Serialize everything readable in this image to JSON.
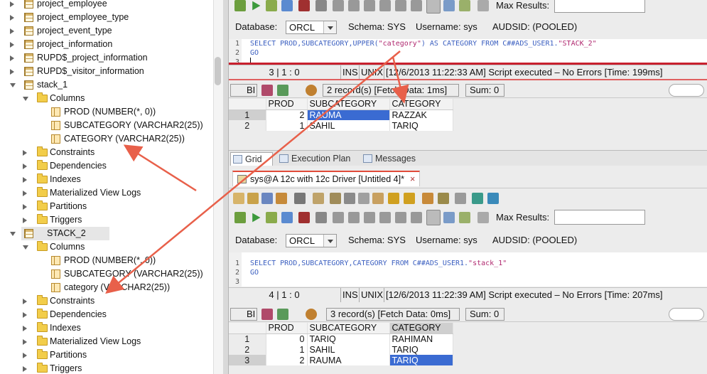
{
  "tree": {
    "items": [
      {
        "label": "project_employee",
        "icon": "table-icon"
      },
      {
        "label": "project_employee_type",
        "icon": "table-icon"
      },
      {
        "label": "project_event_type",
        "icon": "table-icon"
      },
      {
        "label": "project_information",
        "icon": "table-icon"
      },
      {
        "label": "RUPD$_project_information",
        "icon": "table-icon"
      },
      {
        "label": "RUPD$_visitor_information",
        "icon": "table-icon"
      },
      {
        "label": "stack_1",
        "icon": "table-icon"
      },
      {
        "label": "Columns",
        "icon": "folder-icon"
      },
      {
        "label": "PROD (NUMBER(*, 0))",
        "icon": "column-icon"
      },
      {
        "label": "SUBCATEGORY (VARCHAR2(25))",
        "icon": "column-icon"
      },
      {
        "label": "CATEGORY (VARCHAR2(25))",
        "icon": "column-icon"
      },
      {
        "label": "Constraints",
        "icon": "folder-icon"
      },
      {
        "label": "Dependencies",
        "icon": "folder-icon"
      },
      {
        "label": "Indexes",
        "icon": "folder-icon"
      },
      {
        "label": "Materialized View Logs",
        "icon": "folder-icon"
      },
      {
        "label": "Partitions",
        "icon": "folder-icon"
      },
      {
        "label": "Triggers",
        "icon": "folder-icon"
      },
      {
        "label": "STACK_2",
        "icon": "table-icon"
      },
      {
        "label": "Columns",
        "icon": "folder-icon"
      },
      {
        "label": "PROD (NUMBER(*, 0))",
        "icon": "column-icon"
      },
      {
        "label": "SUBCATEGORY (VARCHAR2(25))",
        "icon": "column-icon"
      },
      {
        "label": "category (VARCHAR2(25))",
        "icon": "column-icon"
      },
      {
        "label": "Constraints",
        "icon": "folder-icon"
      },
      {
        "label": "Dependencies",
        "icon": "folder-icon"
      },
      {
        "label": "Indexes",
        "icon": "folder-icon"
      },
      {
        "label": "Materialized View Logs",
        "icon": "folder-icon"
      },
      {
        "label": "Partitions",
        "icon": "folder-icon"
      },
      {
        "label": "Triggers",
        "icon": "folder-icon"
      }
    ]
  },
  "labels": {
    "max_results": "Max Results:",
    "database": "Database:",
    "database_value": "ORCL",
    "schema": "Schema: SYS",
    "username": "Username: sys",
    "audsid": "AUDSID: (POOLED)",
    "bi": "BI",
    "sum": "Sum: 0"
  },
  "top_panel": {
    "code": {
      "line1": {
        "a": "SELECT PROD,SUBCATEGORY,",
        "b": "UPPER",
        "c": "(",
        "d": "\"category\"",
        "e": ") AS CATEGORY FROM C##ADS_USER1.",
        "f": "\"STACK_2\""
      },
      "line2": "GO"
    },
    "gutter": [
      "1",
      "2",
      "3"
    ],
    "status": {
      "pos": "3 | 1 : 0",
      "ins": "INS",
      "unix": "UNIX",
      "msg": "[12/6/2013 11:22:33 AM] Script executed – No Errors [Time: 199ms]"
    },
    "record_info": "2 record(s) [Fetch Data: 1ms]",
    "columns": [
      "PROD",
      "SUBCATEGORY",
      "CATEGORY"
    ],
    "rows": [
      {
        "n": "1",
        "prod": "2",
        "sub": "RAUMA",
        "cat": "RAZZAK"
      },
      {
        "n": "2",
        "prod": "1",
        "sub": "SAHIL",
        "cat": "TARIQ"
      }
    ],
    "tabs": [
      "Grid",
      "Execution Plan",
      "Messages"
    ]
  },
  "doc_tab": "sys@A 12c with 12c Driver [Untitled 4]*",
  "doc_tab_close": "×",
  "bottom_panel": {
    "code": {
      "line1": {
        "a": "SELECT PROD,SUBCATEGORY,CATEGORY FROM C##ADS_USER1.",
        "b": "\"stack_1\""
      },
      "line2": "GO"
    },
    "gutter": [
      "1",
      "2",
      "3"
    ],
    "status": {
      "pos": "4 | 1 : 0",
      "ins": "INS",
      "unix": "UNIX",
      "msg": "[12/6/2013 11:22:39 AM] Script executed – No Errors [Time: 207ms]"
    },
    "record_info": "3 record(s) [Fetch Data: 0ms]",
    "columns": [
      "PROD",
      "SUBCATEGORY",
      "CATEGORY"
    ],
    "rows": [
      {
        "n": "1",
        "prod": "0",
        "sub": "TARIQ",
        "cat": "RAHIMAN"
      },
      {
        "n": "2",
        "prod": "1",
        "sub": "SAHIL",
        "cat": "TARIQ"
      },
      {
        "n": "3",
        "prod": "2",
        "sub": "RAUMA",
        "cat": "TARIQ"
      }
    ]
  }
}
